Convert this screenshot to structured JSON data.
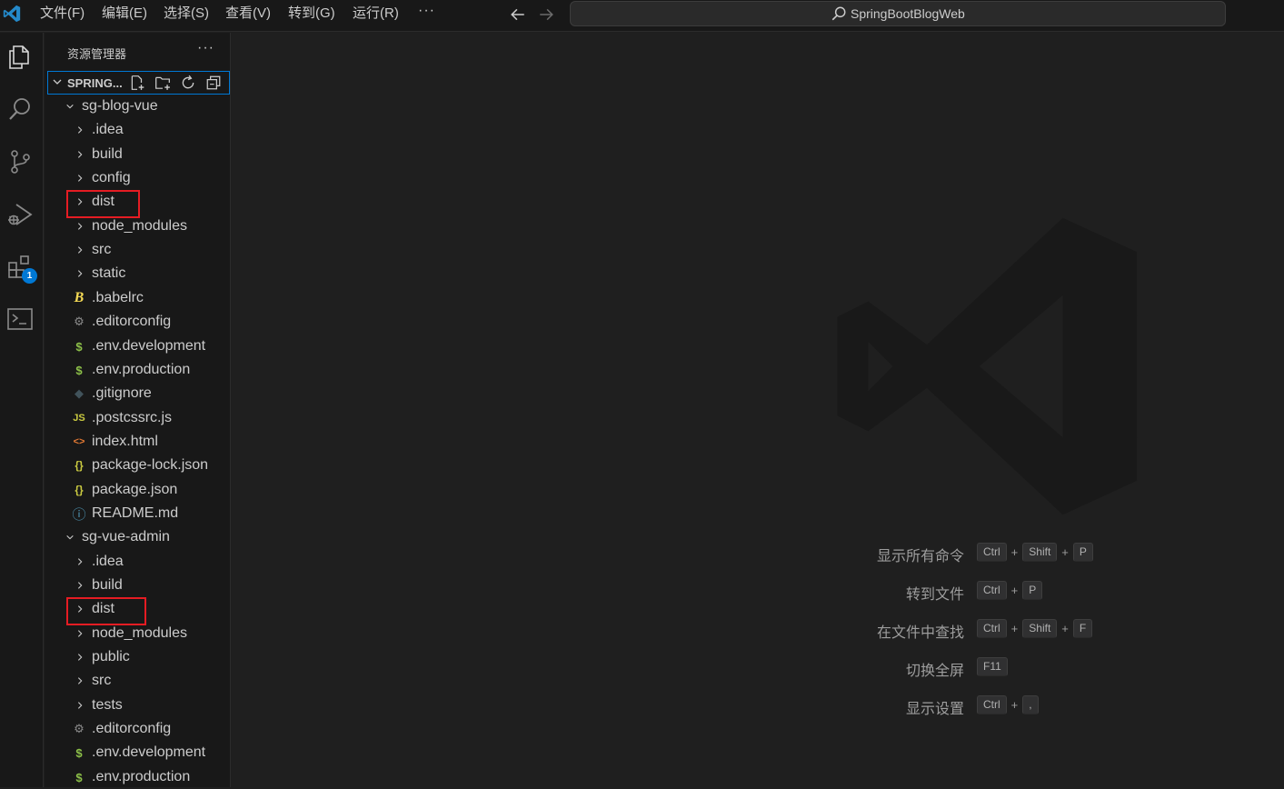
{
  "menu": [
    {
      "label": "文件(F)"
    },
    {
      "label": "编辑(E)"
    },
    {
      "label": "选择(S)"
    },
    {
      "label": "查看(V)"
    },
    {
      "label": "转到(G)"
    },
    {
      "label": "运行(R)"
    }
  ],
  "menu_more": "···",
  "search": {
    "text": "SpringBootBlogWeb"
  },
  "activity_badge": "1",
  "sidebar": {
    "title": "资源管理器",
    "more": "···",
    "section_title": "SPRING..."
  },
  "tree": [
    {
      "label": "sg-blog-vue",
      "kind": "folder-open",
      "icon": "chevron-down-icon"
    },
    {
      "label": ".idea",
      "kind": "folder"
    },
    {
      "label": "build",
      "kind": "folder"
    },
    {
      "label": "config",
      "kind": "folder"
    },
    {
      "label": "dist",
      "kind": "folder"
    },
    {
      "label": "node_modules",
      "kind": "folder"
    },
    {
      "label": "src",
      "kind": "folder"
    },
    {
      "label": "static",
      "kind": "folder"
    },
    {
      "label": ".babelrc",
      "kind": "file",
      "icon": "babel-icon",
      "glyph": "B",
      "color": "#f5da55"
    },
    {
      "label": ".editorconfig",
      "kind": "file",
      "icon": "gear-icon",
      "glyph": "⚙",
      "color": "#8a8a8a"
    },
    {
      "label": ".env.development",
      "kind": "file",
      "icon": "dollar-icon",
      "glyph": "$",
      "color": "#8dc149"
    },
    {
      "label": ".env.production",
      "kind": "file",
      "icon": "dollar-icon",
      "glyph": "$",
      "color": "#8dc149"
    },
    {
      "label": ".gitignore",
      "kind": "file",
      "icon": "git-icon",
      "glyph": "◆",
      "color": "#41535b"
    },
    {
      "label": ".postcssrc.js",
      "kind": "file",
      "icon": "js-icon",
      "glyph": "JS",
      "color": "#cbcb41"
    },
    {
      "label": "index.html",
      "kind": "file",
      "icon": "html-icon",
      "glyph": "<>",
      "color": "#e37933"
    },
    {
      "label": "package-lock.json",
      "kind": "file",
      "icon": "json-icon",
      "glyph": "{}",
      "color": "#cbcb41"
    },
    {
      "label": "package.json",
      "kind": "file",
      "icon": "json-icon",
      "glyph": "{}",
      "color": "#cbcb41"
    },
    {
      "label": "README.md",
      "kind": "file",
      "icon": "info-icon",
      "glyph": "ⓘ",
      "color": "#519aba"
    },
    {
      "label": "sg-vue-admin",
      "kind": "folder-open",
      "icon": "chevron-down-icon"
    },
    {
      "label": ".idea",
      "kind": "folder"
    },
    {
      "label": "build",
      "kind": "folder"
    },
    {
      "label": "dist",
      "kind": "folder"
    },
    {
      "label": "node_modules",
      "kind": "folder"
    },
    {
      "label": "public",
      "kind": "folder"
    },
    {
      "label": "src",
      "kind": "folder"
    },
    {
      "label": "tests",
      "kind": "folder"
    },
    {
      "label": ".editorconfig",
      "kind": "file",
      "icon": "gear-icon",
      "glyph": "⚙",
      "color": "#8a8a8a"
    },
    {
      "label": ".env.development",
      "kind": "file",
      "icon": "dollar-icon",
      "glyph": "$",
      "color": "#8dc149"
    },
    {
      "label": ".env.production",
      "kind": "file",
      "icon": "dollar-icon",
      "glyph": "$",
      "color": "#8dc149"
    }
  ],
  "shortcuts": [
    {
      "label": "显示所有命令",
      "keys": [
        "Ctrl",
        "Shift",
        "P"
      ]
    },
    {
      "label": "转到文件",
      "keys": [
        "Ctrl",
        "P"
      ]
    },
    {
      "label": "在文件中查找",
      "keys": [
        "Ctrl",
        "Shift",
        "F"
      ]
    },
    {
      "label": "切换全屏",
      "keys": [
        "F11"
      ]
    },
    {
      "label": "显示设置",
      "keys": [
        "Ctrl",
        ","
      ]
    }
  ],
  "colors": {
    "accent": "#0078d4",
    "highlight_box": "#e51c23",
    "background": "#1f1f1f",
    "sidebar": "#181818"
  }
}
